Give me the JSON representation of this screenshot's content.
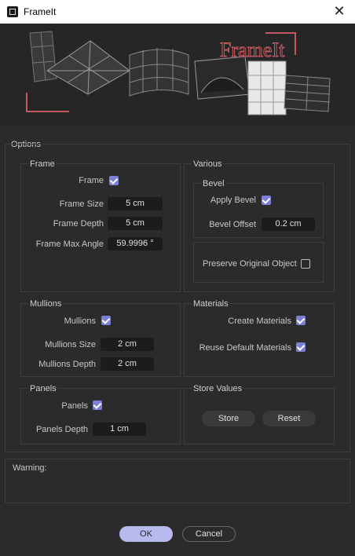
{
  "window": {
    "title": "FrameIt",
    "close_glyph": "✕"
  },
  "banner": {
    "logo_text": "FrameIt"
  },
  "options": {
    "title": "Options",
    "frame": {
      "title": "Frame",
      "frame_label": "Frame",
      "frame_checked": true,
      "size_label": "Frame Size",
      "size_value": "5 cm",
      "depth_label": "Frame Depth",
      "depth_value": "5 cm",
      "max_angle_label": "Frame Max Angle",
      "max_angle_value": "59.9996 °"
    },
    "various": {
      "title": "Various",
      "bevel": {
        "title": "Bevel",
        "apply_label": "Apply Bevel",
        "apply_checked": true,
        "offset_label": "Bevel Offset",
        "offset_value": "0.2 cm"
      },
      "preserve_label": "Preserve Original Object",
      "preserve_checked": false
    },
    "mullions": {
      "title": "Mullions",
      "mullions_label": "Mullions",
      "mullions_checked": true,
      "size_label": "Mullions Size",
      "size_value": "2 cm",
      "depth_label": "Mullions Depth",
      "depth_value": "2 cm"
    },
    "materials": {
      "title": "Materials",
      "create_label": "Create Materials",
      "create_checked": true,
      "reuse_label": "Reuse Default Materials",
      "reuse_checked": true
    },
    "panels": {
      "title": "Panels",
      "panels_label": "Panels",
      "panels_checked": true,
      "depth_label": "Panels Depth",
      "depth_value": "1 cm"
    },
    "store_values": {
      "title": "Store Values",
      "store_label": "Store",
      "reset_label": "Reset"
    }
  },
  "warning": {
    "label": "Warning:"
  },
  "footer": {
    "ok_label": "OK",
    "cancel_label": "Cancel"
  },
  "colors": {
    "accent": "#7b7fd6",
    "ok_button": "#b7b9ef",
    "logo": "#c25a60"
  }
}
